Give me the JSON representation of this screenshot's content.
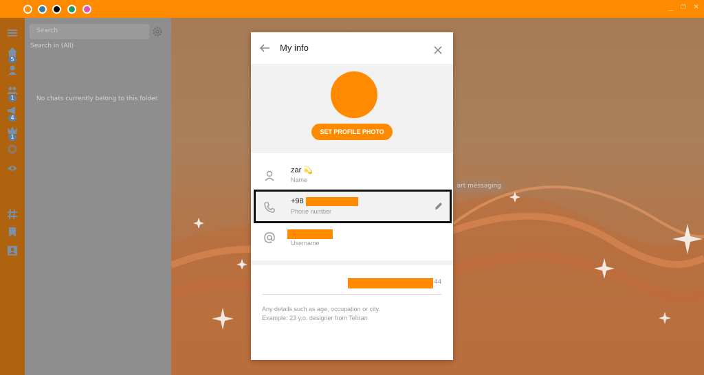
{
  "titlebar": {
    "color_dots": [
      "#ff8a00",
      "#2f7fa6",
      "#000000",
      "#1d9a6c",
      "#e64fb0"
    ],
    "controls": [
      "_",
      "❐",
      "✕"
    ]
  },
  "rail": {
    "badges": {
      "home": "5",
      "groups": "1",
      "channels": "4",
      "bots": "1"
    }
  },
  "list": {
    "search_placeholder": "Search",
    "search_scope": "Search in (All)",
    "empty_text": "No chats currently belong to this folder."
  },
  "chat": {
    "start_messaging": "art messaging"
  },
  "modal": {
    "title": "My info",
    "set_photo_label": "SET PROFILE PHOTO",
    "name": {
      "value": "zar 💫",
      "label": "Name"
    },
    "phone": {
      "prefix": "+98",
      "label": "Phone number"
    },
    "username": {
      "label": "Username"
    },
    "bio": {
      "counter": "44",
      "hint_line1": "Any details such as age, occupation or city.",
      "hint_line2": "Example: 23 y.o. designer from Tehran"
    }
  },
  "colors": {
    "accent": "#ff8a00",
    "rail": "#b0630e",
    "list_bg": "#8e8e8e",
    "highlight_border": "#111111"
  }
}
